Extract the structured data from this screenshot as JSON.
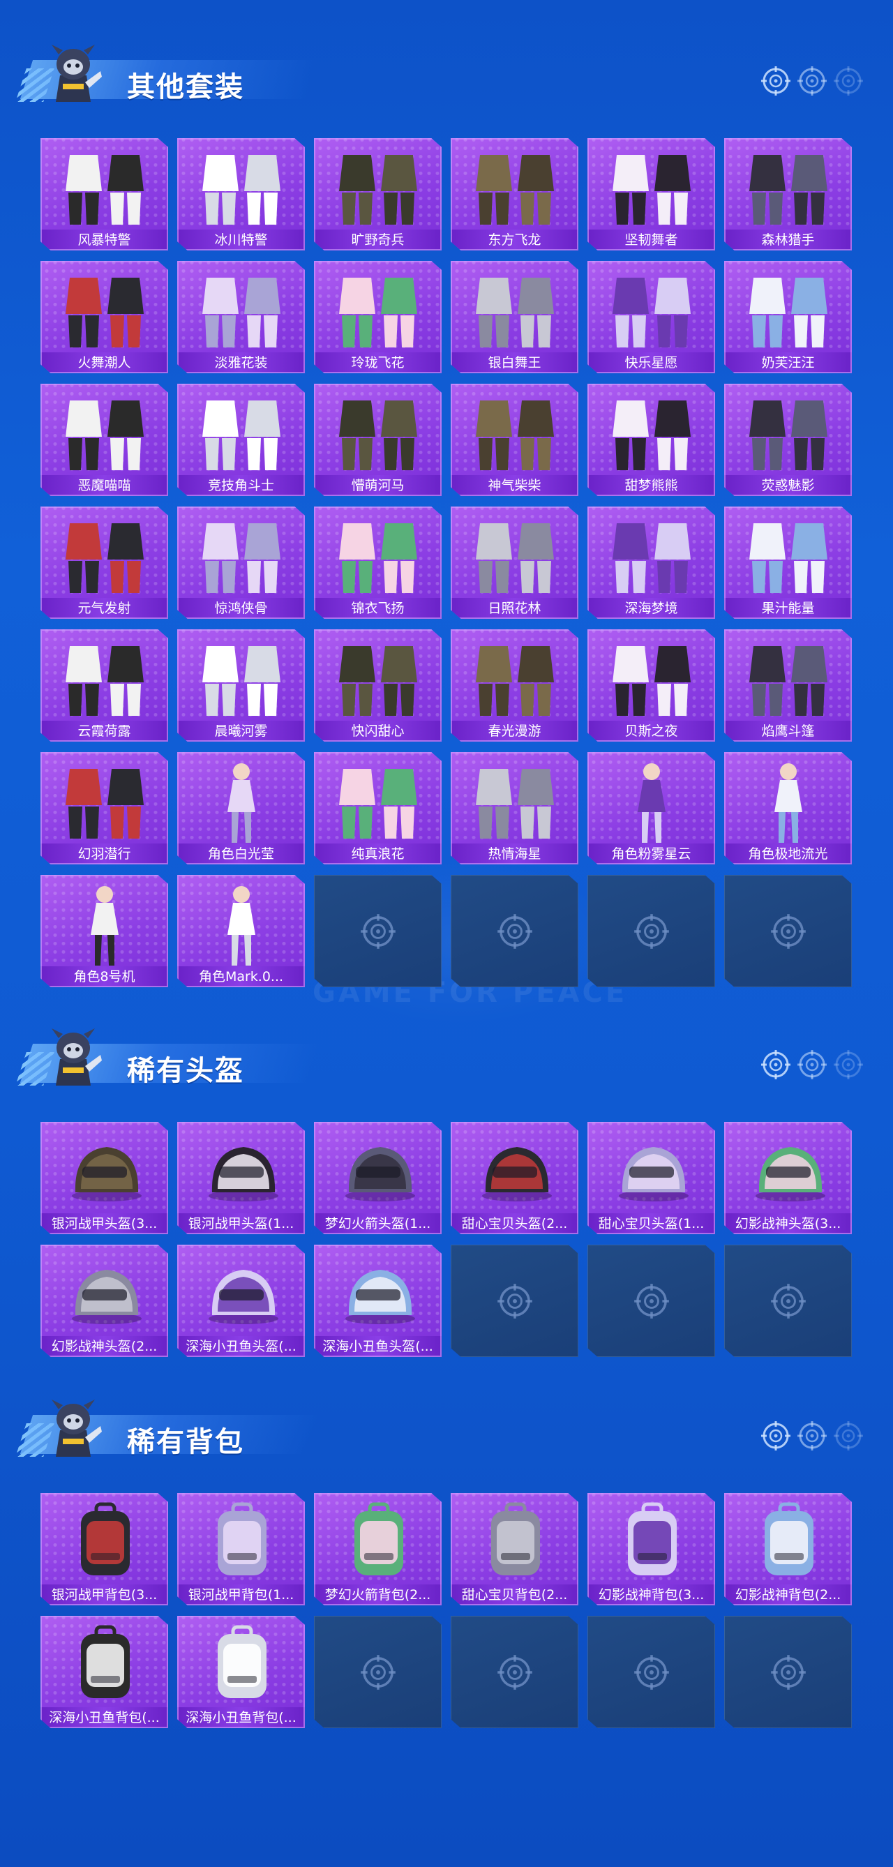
{
  "colors": {
    "background": "#0f5ad2",
    "card_purple": "#9a4aec",
    "caption_purple": "#7a2ed8",
    "empty_slot": "#1e4680",
    "title_white": "#ffffff"
  },
  "watermark": "GAME FOR PEACE",
  "sections": [
    {
      "title": "其他套装",
      "header_icons": [
        "crosshair-icon",
        "crosshair-icon",
        "crosshair-icon"
      ],
      "items": [
        {
          "name": "风暴特警",
          "kind": "outfit-suit"
        },
        {
          "name": "冰川特警",
          "kind": "outfit-suit"
        },
        {
          "name": "旷野奇兵",
          "kind": "outfit-suit"
        },
        {
          "name": "东方飞龙",
          "kind": "outfit-suit"
        },
        {
          "name": "坚韧舞者",
          "kind": "outfit-suit"
        },
        {
          "name": "森林猎手",
          "kind": "outfit-suit"
        },
        {
          "name": "火舞潮人",
          "kind": "outfit-suit"
        },
        {
          "name": "淡雅花装",
          "kind": "outfit-suit"
        },
        {
          "name": "玲珑飞花",
          "kind": "outfit-suit"
        },
        {
          "name": "银白舞王",
          "kind": "outfit-suit"
        },
        {
          "name": "快乐星愿",
          "kind": "outfit-suit"
        },
        {
          "name": "奶芙汪汪",
          "kind": "outfit-suit"
        },
        {
          "name": "恶魔喵喵",
          "kind": "outfit-suit"
        },
        {
          "name": "竞技角斗士",
          "kind": "outfit-suit"
        },
        {
          "name": "懵萌河马",
          "kind": "outfit-suit"
        },
        {
          "name": "神气柴柴",
          "kind": "outfit-suit"
        },
        {
          "name": "甜梦熊熊",
          "kind": "outfit-suit"
        },
        {
          "name": "荧惑魅影",
          "kind": "outfit-suit"
        },
        {
          "name": "元气发射",
          "kind": "outfit-suit"
        },
        {
          "name": "惊鸿侠骨",
          "kind": "outfit-suit"
        },
        {
          "name": "锦衣飞扬",
          "kind": "outfit-suit"
        },
        {
          "name": "日照花林",
          "kind": "outfit-suit"
        },
        {
          "name": "深海梦境",
          "kind": "outfit-suit"
        },
        {
          "name": "果汁能量",
          "kind": "outfit-suit"
        },
        {
          "name": "云霞荷露",
          "kind": "outfit-suit"
        },
        {
          "name": "晨曦河雾",
          "kind": "outfit-suit"
        },
        {
          "name": "快闪甜心",
          "kind": "outfit-suit"
        },
        {
          "name": "春光漫游",
          "kind": "outfit-suit"
        },
        {
          "name": "贝斯之夜",
          "kind": "outfit-suit"
        },
        {
          "name": "焰鹰斗篷",
          "kind": "outfit-suit"
        },
        {
          "name": "幻羽潜行",
          "kind": "outfit-suit"
        },
        {
          "name": "角色白光莹",
          "kind": "outfit-character"
        },
        {
          "name": "纯真浪花",
          "kind": "outfit-suit"
        },
        {
          "name": "热情海星",
          "kind": "outfit-suit"
        },
        {
          "name": "角色粉雾星云",
          "kind": "outfit-character"
        },
        {
          "name": "角色极地流光",
          "kind": "outfit-character"
        },
        {
          "name": "角色8号机",
          "kind": "outfit-character"
        },
        {
          "name": "角色Mark.0...",
          "kind": "outfit-character"
        }
      ],
      "empty_slots": 4
    },
    {
      "title": "稀有头盔",
      "header_icons": [
        "crosshair-icon",
        "crosshair-icon",
        "crosshair-icon"
      ],
      "items": [
        {
          "name": "银河战甲头盔(3...",
          "kind": "helmet"
        },
        {
          "name": "银河战甲头盔(1...",
          "kind": "helmet"
        },
        {
          "name": "梦幻火箭头盔(1...",
          "kind": "helmet"
        },
        {
          "name": "甜心宝贝头盔(2...",
          "kind": "helmet"
        },
        {
          "name": "甜心宝贝头盔(1...",
          "kind": "helmet"
        },
        {
          "name": "幻影战神头盔(3...",
          "kind": "helmet"
        },
        {
          "name": "幻影战神头盔(2...",
          "kind": "helmet"
        },
        {
          "name": "深海小丑鱼头盔(...",
          "kind": "helmet"
        },
        {
          "name": "深海小丑鱼头盔(...",
          "kind": "helmet"
        }
      ],
      "empty_slots": 3
    },
    {
      "title": "稀有背包",
      "header_icons": [
        "crosshair-icon",
        "crosshair-icon",
        "crosshair-icon"
      ],
      "items": [
        {
          "name": "银河战甲背包(3...",
          "kind": "backpack"
        },
        {
          "name": "银河战甲背包(1...",
          "kind": "backpack"
        },
        {
          "name": "梦幻火箭背包(2...",
          "kind": "backpack"
        },
        {
          "name": "甜心宝贝背包(2...",
          "kind": "backpack"
        },
        {
          "name": "幻影战神背包(3...",
          "kind": "backpack"
        },
        {
          "name": "幻影战神背包(2...",
          "kind": "backpack"
        },
        {
          "name": "深海小丑鱼背包(...",
          "kind": "backpack"
        },
        {
          "name": "深海小丑鱼背包(...",
          "kind": "backpack"
        }
      ],
      "empty_slots": 4
    }
  ]
}
